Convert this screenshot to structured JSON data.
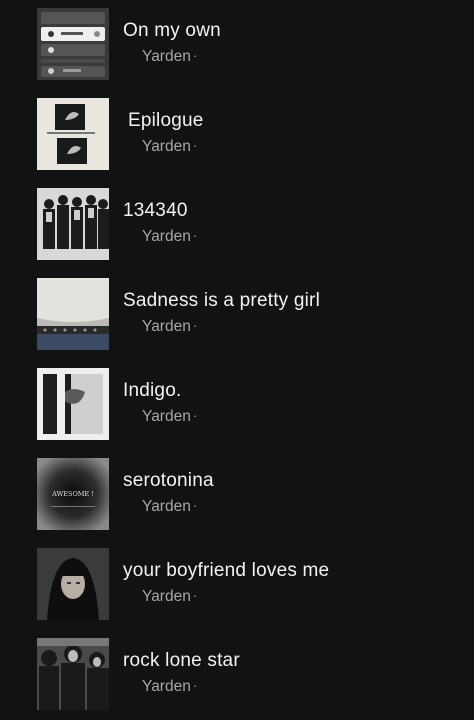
{
  "playlists": [
    {
      "title": "On my own",
      "owner": "Yarden",
      "separator": "·",
      "cover": "phone-screenshot-cover"
    },
    {
      "title": "Epilogue",
      "owner": "Yarden",
      "separator": "·",
      "cover": "two-photos-cover"
    },
    {
      "title": "134340",
      "owner": "Yarden",
      "separator": "·",
      "cover": "group-photo-cover"
    },
    {
      "title": "Sadness is a pretty girl",
      "owner": "Yarden",
      "separator": "·",
      "cover": "belt-torso-cover"
    },
    {
      "title": "Indigo.",
      "owner": "Yarden",
      "separator": "·",
      "cover": "abstract-figure-cover"
    },
    {
      "title": "serotonina",
      "owner": "Yarden",
      "separator": "·",
      "cover": "awesome-cover"
    },
    {
      "title": "your boyfriend loves me",
      "owner": "Yarden",
      "separator": "·",
      "cover": "portrait-cover"
    },
    {
      "title": "rock lone star",
      "owner": "Yarden",
      "separator": "·",
      "cover": "crowd-cover"
    }
  ],
  "cover_text": {
    "awesome": "AWESOME !"
  },
  "colors": {
    "background": "#121212",
    "title": "#f2f2f2",
    "subtitle": "#a7a7a7"
  }
}
